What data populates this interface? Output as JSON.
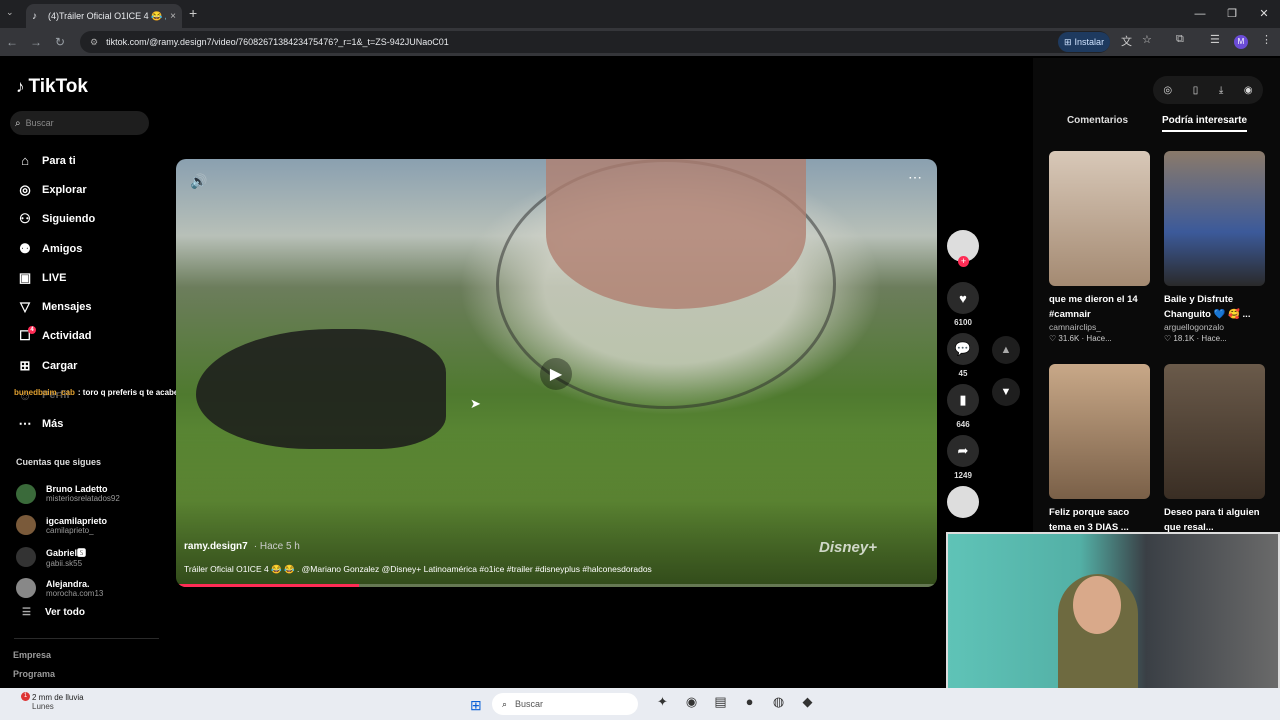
{
  "browser": {
    "tab_title": "(4)Tráiler Oficial O1ICE 4 😂 🔊",
    "tab_close": "×",
    "new_tab": "+",
    "url": "tiktok.com/@ramy.design7/video/7608267138423475476?_r=1&_t=ZS-942JUNaoC01",
    "install_label": "Instalar",
    "profile_initial": "M"
  },
  "sidebar": {
    "logo": "TikTok",
    "search_placeholder": "Buscar",
    "menu": [
      {
        "label": "Para ti",
        "icon": "home-icon"
      },
      {
        "label": "Explorar",
        "icon": "compass-icon"
      },
      {
        "label": "Siguiendo",
        "icon": "following-icon"
      },
      {
        "label": "Amigos",
        "icon": "friends-icon"
      },
      {
        "label": "LIVE",
        "icon": "live-icon"
      },
      {
        "label": "Mensajes",
        "icon": "messages-icon"
      },
      {
        "label": "Actividad",
        "icon": "activity-icon",
        "badge": "4"
      },
      {
        "label": "Cargar",
        "icon": "upload-icon"
      },
      {
        "label": "Perfil",
        "icon": "profile-icon"
      },
      {
        "label": "Más",
        "icon": "more-icon"
      }
    ],
    "chat_overlay": {
      "user": "bunedbaim_cab",
      "text": ": toro q preferis q te acaben en la cara o en la cola?"
    },
    "following_title": "Cuentas que sigues",
    "following": [
      {
        "name": "Bruno Ladetto",
        "handle": "misteriosrelatados92"
      },
      {
        "name": "igcamilaprieto",
        "handle": "camilaprieto_"
      },
      {
        "name": "Gabriel🆂",
        "handle": "gabii.sk55"
      },
      {
        "name": "Alejandra.",
        "handle": "morocha.com13"
      }
    ],
    "see_all": "Ver todo",
    "footer": [
      "Empresa",
      "Programa"
    ]
  },
  "video": {
    "author": "ramy.design7",
    "time": "· Hace 5 h",
    "description": "Tráiler Oficial O1ICE 4 😂 😂 . @Mariano Gonzalez @Disney+ Latinoamérica #o1ice #trailer #disneyplus #halconesdorados",
    "watermark": "Disney+",
    "progress": 0.24
  },
  "actions": {
    "likes": "6100",
    "comments": "45",
    "saves": "646",
    "shares": "1249"
  },
  "panel": {
    "tabs": [
      "Comentarios",
      "Podría interesarte"
    ],
    "cards": [
      {
        "title": "que me dieron el 14 #camnair",
        "author": "camnairclips_",
        "stats": "♡ 31.6K · Hace...",
        "color": "#c9b8a8"
      },
      {
        "title": "Baile y Disfrute Changuito 💙 🥰 ...",
        "author": "arguellogonzalo",
        "stats": "♡ 18.1K · Hace...",
        "color": "#6a7c8a"
      },
      {
        "title": "Feliz porque saco tema en 3 DIAS ...",
        "author": "",
        "stats": "",
        "color": "#b89a80"
      },
      {
        "title": "Deseo para ti alguien que resal...",
        "author": "",
        "stats": "",
        "color": "#5a4a3a"
      }
    ]
  },
  "taskbar": {
    "weather_line1": "2 mm de lluvia",
    "weather_line2": "Lunes",
    "weather_badge": "1",
    "search_placeholder": "Buscar"
  }
}
